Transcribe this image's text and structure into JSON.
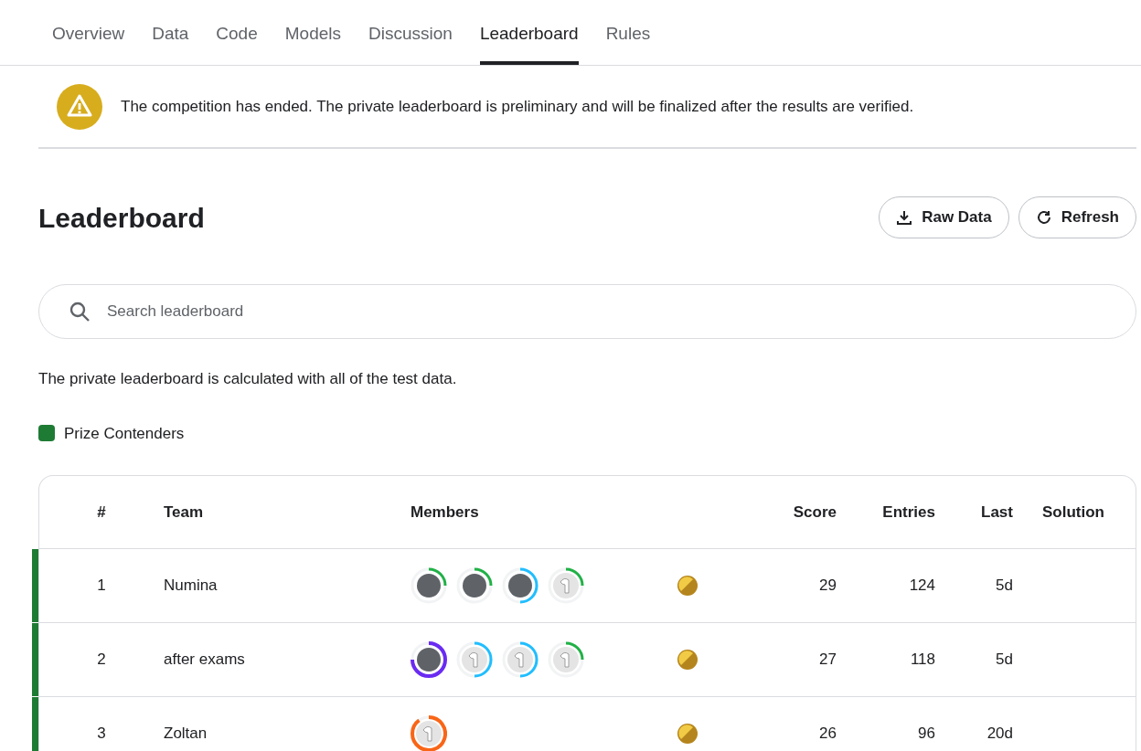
{
  "tabs": [
    {
      "label": "Overview",
      "selected": false
    },
    {
      "label": "Data",
      "selected": false
    },
    {
      "label": "Code",
      "selected": false
    },
    {
      "label": "Models",
      "selected": false
    },
    {
      "label": "Discussion",
      "selected": false
    },
    {
      "label": "Leaderboard",
      "selected": true
    },
    {
      "label": "Rules",
      "selected": false
    }
  ],
  "notice": "The competition has ended. The private leaderboard is preliminary and will be finalized after the results are verified.",
  "title": "Leaderboard",
  "buttons": [
    {
      "kind": "download",
      "label": "Raw Data"
    },
    {
      "kind": "refresh",
      "label": "Refresh"
    }
  ],
  "search": {
    "placeholder": "Search leaderboard"
  },
  "description": "The private leaderboard is calculated with all of the test data.",
  "legend": {
    "label": "Prize Contenders",
    "color": "#1e7b34"
  },
  "table": {
    "columns": [
      "#",
      "Team",
      "Members",
      "Score",
      "Entries",
      "Last",
      "Solution"
    ],
    "rows": [
      {
        "rank": "1",
        "team": "Numina",
        "prize": true,
        "score": "29",
        "entries": "124",
        "last": "5d",
        "members": [
          {
            "kind": "photo",
            "color": "#20b146"
          },
          {
            "kind": "photo",
            "color": "#20b146"
          },
          {
            "kind": "photo",
            "color": "#20beff"
          },
          {
            "kind": "default",
            "color": "#20b146"
          }
        ]
      },
      {
        "rank": "2",
        "team": "after exams",
        "prize": true,
        "score": "27",
        "entries": "118",
        "last": "5d",
        "members": [
          {
            "kind": "photo",
            "color": "#6a2bf2"
          },
          {
            "kind": "default",
            "color": "#20beff"
          },
          {
            "kind": "default",
            "color": "#20beff"
          },
          {
            "kind": "default",
            "color": "#20b146"
          }
        ]
      },
      {
        "rank": "3",
        "team": "Zoltan",
        "prize": true,
        "score": "26",
        "entries": "96",
        "last": "20d",
        "members": [
          {
            "kind": "default",
            "color": "#f96517"
          }
        ]
      }
    ]
  }
}
